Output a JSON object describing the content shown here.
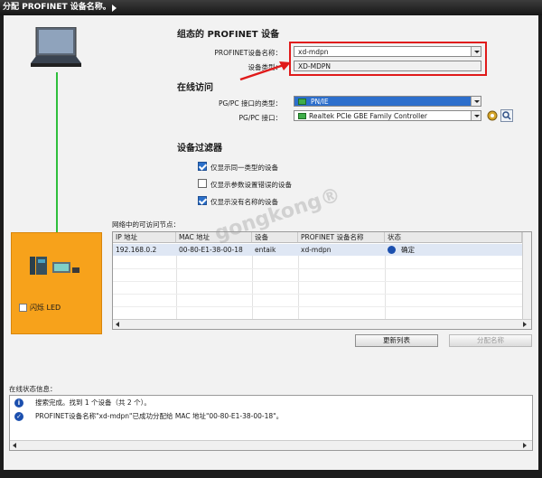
{
  "window": {
    "title": "分配 PROFINET 设备名称。"
  },
  "device_panel": {
    "flash_led_label": "闪烁 LED"
  },
  "configured_device": {
    "heading": "组态的 PROFINET 设备",
    "name_label": "PROFINET设备名称：",
    "name_value": "xd-mdpn",
    "type_label": "设备类型：",
    "type_value": "XD-MDPN"
  },
  "online_access": {
    "heading": "在线访问",
    "interface_type_label": "PG/PC 接口的类型：",
    "interface_type_value": "PN/IE",
    "interface_label": "PG/PC 接口：",
    "interface_value": "Realtek PCIe GBE Family Controller"
  },
  "device_filter": {
    "heading": "设备过滤器",
    "options": [
      {
        "label": "仅显示同一类型的设备",
        "checked": true
      },
      {
        "label": "仅显示参数设置错误的设备",
        "checked": false
      },
      {
        "label": "仅显示没有名称的设备",
        "checked": true
      }
    ]
  },
  "accessible_nodes": {
    "label": "网络中的可访问节点：",
    "columns": [
      "IP 地址",
      "MAC 地址",
      "设备",
      "PROFINET 设备名称",
      "状态"
    ],
    "rows": [
      {
        "ip": "192.168.0.2",
        "mac": "00-80-E1-38-00-18",
        "device": "entaik",
        "name": "xd-mdpn",
        "status": "确定"
      }
    ]
  },
  "buttons": {
    "refresh": "更新列表",
    "assign": "分配名称"
  },
  "online_status": {
    "label": "在线状态信息：",
    "messages": [
      {
        "icon": "info-icon",
        "text": "搜索完成。找到 1 个设备（共 2 个）。"
      },
      {
        "icon": "check-icon",
        "text": "PROFINET设备名称\"xd-mdpn\"已成功分配给 MAC 地址\"00-80-E1-38-00-18\"。"
      }
    ]
  },
  "watermark": {
    "text": "gongkong®"
  },
  "colors": {
    "accent": "#f7a21b",
    "highlight": "#e01a1a",
    "selection": "#2d6fcc"
  }
}
